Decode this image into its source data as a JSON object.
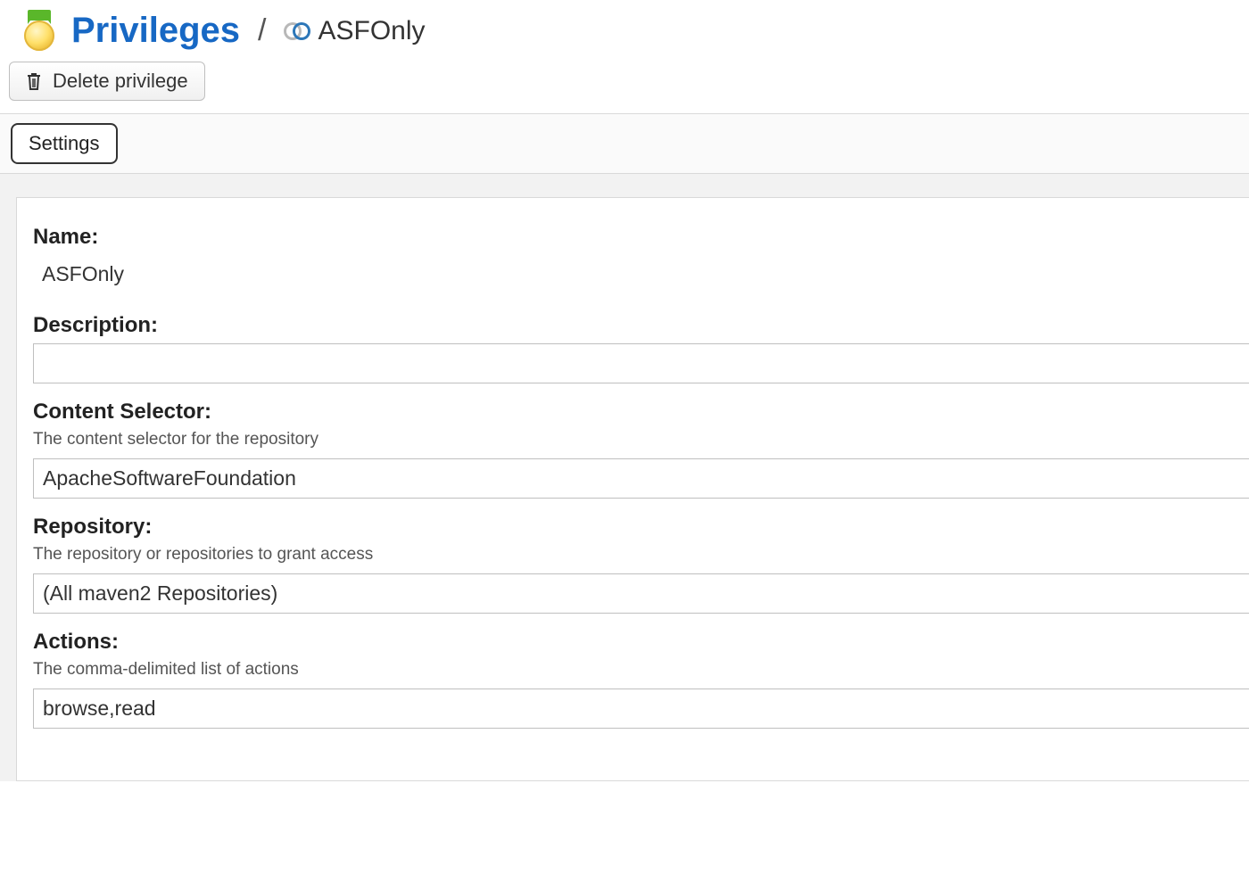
{
  "breadcrumb": {
    "root_label": "Privileges",
    "separator": "/",
    "item_label": "ASFOnly"
  },
  "toolbar": {
    "delete_label": "Delete privilege"
  },
  "tabs": {
    "settings_label": "Settings"
  },
  "form": {
    "name": {
      "label": "Name:",
      "value": "ASFOnly"
    },
    "description": {
      "label": "Description:",
      "value": ""
    },
    "content_selector": {
      "label": "Content Selector:",
      "help": "The content selector for the repository",
      "value": "ApacheSoftwareFoundation"
    },
    "repository": {
      "label": "Repository:",
      "help": "The repository or repositories to grant access",
      "value": "(All maven2 Repositories)"
    },
    "actions": {
      "label": "Actions:",
      "help": "The comma-delimited list of actions",
      "value": "browse,read"
    }
  }
}
